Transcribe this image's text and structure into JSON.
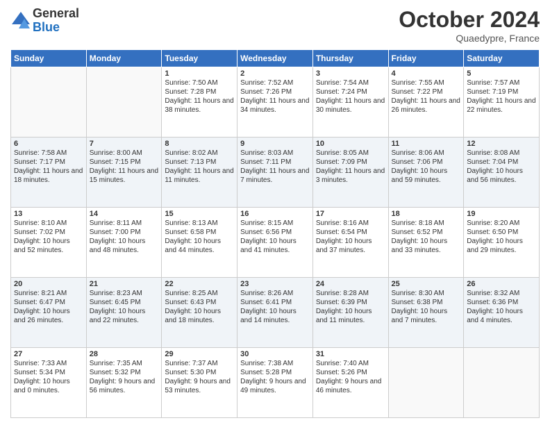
{
  "logo": {
    "general": "General",
    "blue": "Blue"
  },
  "title": "October 2024",
  "location": "Quaedypre, France",
  "weekdays": [
    "Sunday",
    "Monday",
    "Tuesday",
    "Wednesday",
    "Thursday",
    "Friday",
    "Saturday"
  ],
  "weeks": [
    [
      {
        "day": "",
        "info": ""
      },
      {
        "day": "",
        "info": ""
      },
      {
        "day": "1",
        "info": "Sunrise: 7:50 AM\nSunset: 7:28 PM\nDaylight: 11 hours and 38 minutes."
      },
      {
        "day": "2",
        "info": "Sunrise: 7:52 AM\nSunset: 7:26 PM\nDaylight: 11 hours and 34 minutes."
      },
      {
        "day": "3",
        "info": "Sunrise: 7:54 AM\nSunset: 7:24 PM\nDaylight: 11 hours and 30 minutes."
      },
      {
        "day": "4",
        "info": "Sunrise: 7:55 AM\nSunset: 7:22 PM\nDaylight: 11 hours and 26 minutes."
      },
      {
        "day": "5",
        "info": "Sunrise: 7:57 AM\nSunset: 7:19 PM\nDaylight: 11 hours and 22 minutes."
      }
    ],
    [
      {
        "day": "6",
        "info": "Sunrise: 7:58 AM\nSunset: 7:17 PM\nDaylight: 11 hours and 18 minutes."
      },
      {
        "day": "7",
        "info": "Sunrise: 8:00 AM\nSunset: 7:15 PM\nDaylight: 11 hours and 15 minutes."
      },
      {
        "day": "8",
        "info": "Sunrise: 8:02 AM\nSunset: 7:13 PM\nDaylight: 11 hours and 11 minutes."
      },
      {
        "day": "9",
        "info": "Sunrise: 8:03 AM\nSunset: 7:11 PM\nDaylight: 11 hours and 7 minutes."
      },
      {
        "day": "10",
        "info": "Sunrise: 8:05 AM\nSunset: 7:09 PM\nDaylight: 11 hours and 3 minutes."
      },
      {
        "day": "11",
        "info": "Sunrise: 8:06 AM\nSunset: 7:06 PM\nDaylight: 10 hours and 59 minutes."
      },
      {
        "day": "12",
        "info": "Sunrise: 8:08 AM\nSunset: 7:04 PM\nDaylight: 10 hours and 56 minutes."
      }
    ],
    [
      {
        "day": "13",
        "info": "Sunrise: 8:10 AM\nSunset: 7:02 PM\nDaylight: 10 hours and 52 minutes."
      },
      {
        "day": "14",
        "info": "Sunrise: 8:11 AM\nSunset: 7:00 PM\nDaylight: 10 hours and 48 minutes."
      },
      {
        "day": "15",
        "info": "Sunrise: 8:13 AM\nSunset: 6:58 PM\nDaylight: 10 hours and 44 minutes."
      },
      {
        "day": "16",
        "info": "Sunrise: 8:15 AM\nSunset: 6:56 PM\nDaylight: 10 hours and 41 minutes."
      },
      {
        "day": "17",
        "info": "Sunrise: 8:16 AM\nSunset: 6:54 PM\nDaylight: 10 hours and 37 minutes."
      },
      {
        "day": "18",
        "info": "Sunrise: 8:18 AM\nSunset: 6:52 PM\nDaylight: 10 hours and 33 minutes."
      },
      {
        "day": "19",
        "info": "Sunrise: 8:20 AM\nSunset: 6:50 PM\nDaylight: 10 hours and 29 minutes."
      }
    ],
    [
      {
        "day": "20",
        "info": "Sunrise: 8:21 AM\nSunset: 6:47 PM\nDaylight: 10 hours and 26 minutes."
      },
      {
        "day": "21",
        "info": "Sunrise: 8:23 AM\nSunset: 6:45 PM\nDaylight: 10 hours and 22 minutes."
      },
      {
        "day": "22",
        "info": "Sunrise: 8:25 AM\nSunset: 6:43 PM\nDaylight: 10 hours and 18 minutes."
      },
      {
        "day": "23",
        "info": "Sunrise: 8:26 AM\nSunset: 6:41 PM\nDaylight: 10 hours and 14 minutes."
      },
      {
        "day": "24",
        "info": "Sunrise: 8:28 AM\nSunset: 6:39 PM\nDaylight: 10 hours and 11 minutes."
      },
      {
        "day": "25",
        "info": "Sunrise: 8:30 AM\nSunset: 6:38 PM\nDaylight: 10 hours and 7 minutes."
      },
      {
        "day": "26",
        "info": "Sunrise: 8:32 AM\nSunset: 6:36 PM\nDaylight: 10 hours and 4 minutes."
      }
    ],
    [
      {
        "day": "27",
        "info": "Sunrise: 7:33 AM\nSunset: 5:34 PM\nDaylight: 10 hours and 0 minutes."
      },
      {
        "day": "28",
        "info": "Sunrise: 7:35 AM\nSunset: 5:32 PM\nDaylight: 9 hours and 56 minutes."
      },
      {
        "day": "29",
        "info": "Sunrise: 7:37 AM\nSunset: 5:30 PM\nDaylight: 9 hours and 53 minutes."
      },
      {
        "day": "30",
        "info": "Sunrise: 7:38 AM\nSunset: 5:28 PM\nDaylight: 9 hours and 49 minutes."
      },
      {
        "day": "31",
        "info": "Sunrise: 7:40 AM\nSunset: 5:26 PM\nDaylight: 9 hours and 46 minutes."
      },
      {
        "day": "",
        "info": ""
      },
      {
        "day": "",
        "info": ""
      }
    ]
  ]
}
